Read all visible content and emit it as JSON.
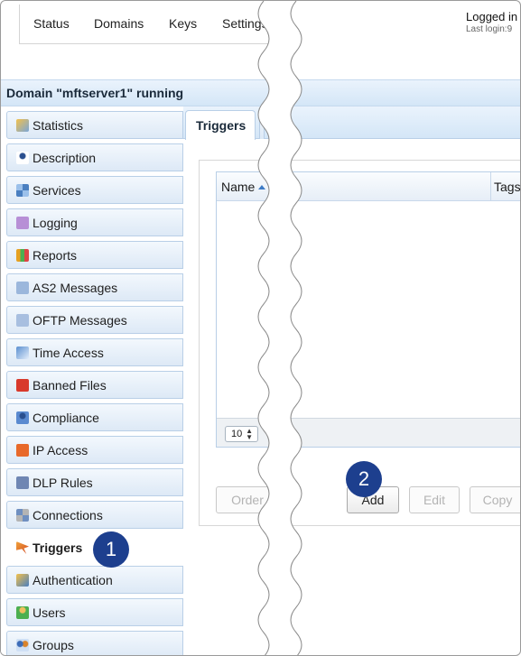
{
  "topnav": {
    "items": [
      "Status",
      "Domains",
      "Keys",
      "Settings"
    ]
  },
  "login": {
    "title": "Logged in",
    "subtitle": "Last login:9"
  },
  "domain": {
    "title": "Domain \"mftserver1\" running"
  },
  "sidebar": {
    "items": [
      {
        "label": "Statistics",
        "icon": "statistics-icon"
      },
      {
        "label": "Description",
        "icon": "description-icon"
      },
      {
        "label": "Services",
        "icon": "services-icon"
      },
      {
        "label": "Logging",
        "icon": "logging-icon"
      },
      {
        "label": "Reports",
        "icon": "reports-icon"
      },
      {
        "label": "AS2 Messages",
        "icon": "as2-messages-icon"
      },
      {
        "label": "OFTP Messages",
        "icon": "oftp-messages-icon"
      },
      {
        "label": "Time Access",
        "icon": "time-access-icon"
      },
      {
        "label": "Banned Files",
        "icon": "banned-files-icon"
      },
      {
        "label": "Compliance",
        "icon": "compliance-icon"
      },
      {
        "label": "IP Access",
        "icon": "ip-access-icon"
      },
      {
        "label": "DLP Rules",
        "icon": "dlp-rules-icon"
      },
      {
        "label": "Connections",
        "icon": "connections-icon"
      },
      {
        "label": "Triggers",
        "icon": "triggers-icon",
        "active": true
      },
      {
        "label": "Authentication",
        "icon": "authentication-icon"
      },
      {
        "label": "Users",
        "icon": "users-icon"
      },
      {
        "label": "Groups",
        "icon": "groups-icon"
      }
    ]
  },
  "main": {
    "tab_label": "Triggers",
    "grid": {
      "columns": [
        "Name",
        "Tags"
      ],
      "sort_column": "Name",
      "sort_direction": "ascending",
      "page_size": "10"
    },
    "buttons": [
      {
        "label": "Order",
        "enabled": false
      },
      {
        "label": "Add",
        "enabled": true
      },
      {
        "label": "Edit",
        "enabled": false
      },
      {
        "label": "Copy",
        "enabled": false
      }
    ]
  },
  "callouts": [
    "1",
    "2"
  ],
  "colors": {
    "accent_bar": "#d4e6f7",
    "border": "#b9cfe7",
    "callout": "#1d3f8e"
  }
}
